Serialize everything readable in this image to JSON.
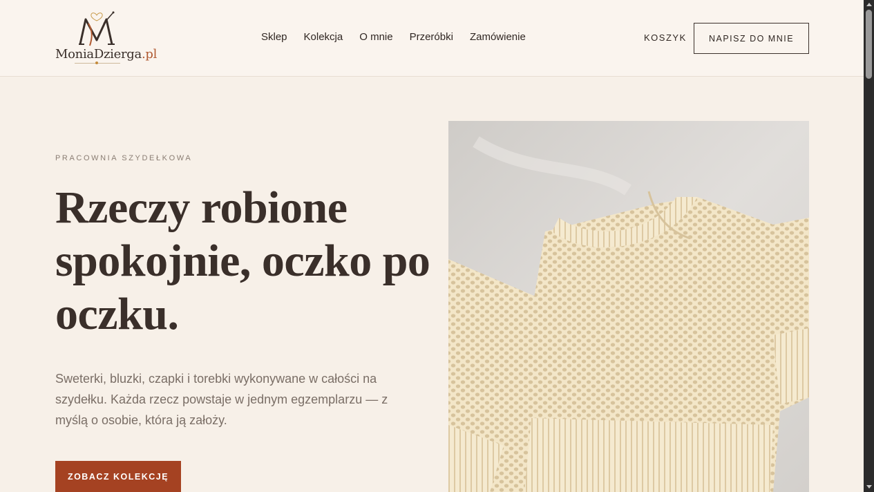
{
  "header": {
    "logo_text_main": "MoniaDzierga",
    "logo_text_tld": ".pl",
    "nav": [
      {
        "label": "Sklep"
      },
      {
        "label": "Kolekcja"
      },
      {
        "label": "O mnie"
      },
      {
        "label": "Przeróbki"
      },
      {
        "label": "Zamówienie"
      }
    ],
    "cart_label": "KOSZYK",
    "write_button_label": "NAPISZ DO MNIE"
  },
  "hero": {
    "eyebrow": "PRACOWNIA SZYDEŁKOWA",
    "headline": "Rzeczy robione spokojnie, oczko po oczku.",
    "lead": "Sweterki, bluzki, czapki i torebki wykonywane w całości na szydełku. Każda rzecz powstaje w jednym egzemplarzu — z myślą o osobie, która ją założy.",
    "cta_label": "ZOBACZ KOLEKCJĘ"
  },
  "colors": {
    "background": "#f7f0e8",
    "header_background": "#faf4ee",
    "accent": "#a54222",
    "logo_accent": "#b05a32",
    "text_dark": "#3a2f2a",
    "text_muted": "#7a6e66",
    "sweater": "#f3e6c8"
  },
  "icons": {
    "logo_mark": "monogram-m-heart-icon"
  }
}
